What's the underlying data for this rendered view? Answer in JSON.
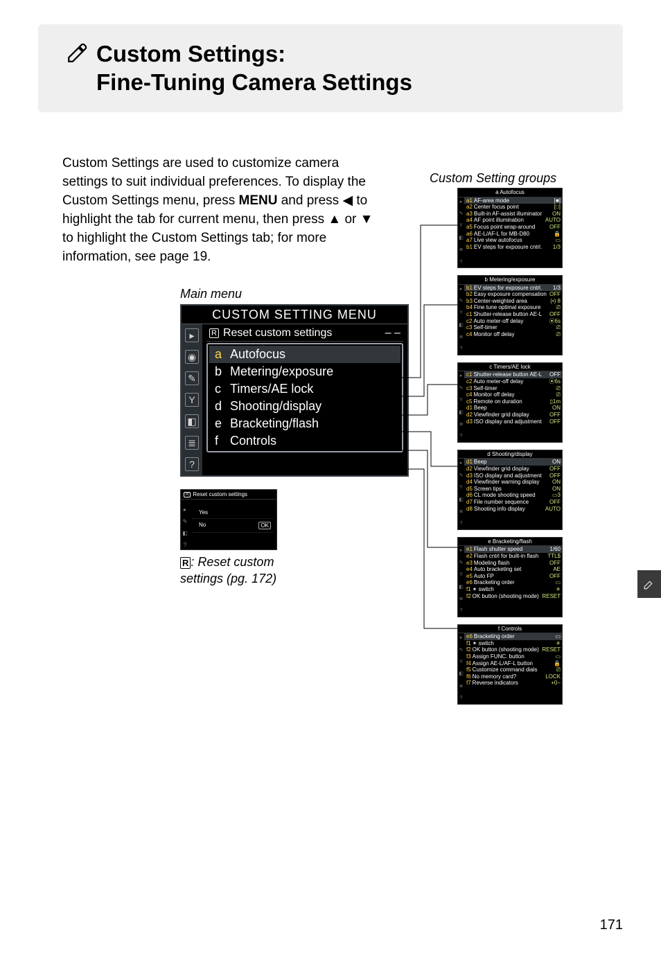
{
  "header": {
    "title_line1": "Custom Settings:",
    "title_line2": "Fine-Tuning Camera Settings"
  },
  "intro": {
    "text_a": "Custom Settings are used to customize camera settings to suit individual preferences.  To display the Custom Settings menu, press ",
    "menu_word": "MENU",
    "text_b": " and press ",
    "arrow_left": "◀",
    "text_c": " to highlight the tab for current menu, then press ",
    "arrow_up": "▲",
    "text_d": " or ",
    "arrow_down": "▼",
    "text_e": " to highlight the Custom Settings tab; for more information, see page 19."
  },
  "main_menu": {
    "caption": "Main menu",
    "title": "CUSTOM SETTING MENU",
    "reset_badge": "R",
    "reset_label": "Reset custom settings",
    "reset_value": "– –",
    "items": [
      {
        "code": "a",
        "label": "Autofocus"
      },
      {
        "code": "b",
        "label": "Metering/exposure"
      },
      {
        "code": "c",
        "label": "Timers/AE lock"
      },
      {
        "code": "d",
        "label": "Shooting/display"
      },
      {
        "code": "e",
        "label": "Bracketing/flash"
      },
      {
        "code": "f",
        "label": "Controls"
      }
    ]
  },
  "reset_dialog": {
    "head_badge": "R",
    "head_label": "Reset custom settings",
    "yes": "Yes",
    "no": "No",
    "ok": "OK"
  },
  "reset_caption": {
    "badge": "R",
    "text": ": Reset custom settings (pg. 172)"
  },
  "groups_caption": "Custom Setting groups",
  "groups": [
    {
      "title": "a Autofocus",
      "rows": [
        {
          "code": "a1",
          "name": "AF-area mode",
          "val": "[■]"
        },
        {
          "code": "a2",
          "name": "Center focus point",
          "val": "[□]"
        },
        {
          "code": "a3",
          "name": "Built-in AF-assist illuminator",
          "val": "ON"
        },
        {
          "code": "a4",
          "name": "AF point illumination",
          "val": "AUTO"
        },
        {
          "code": "a5",
          "name": "Focus point wrap-around",
          "val": "OFF"
        },
        {
          "code": "a6",
          "name": "AE-L/AF-L for MB-D80",
          "val": "🔒"
        },
        {
          "code": "a7",
          "name": "Live view autofocus",
          "val": "▭"
        },
        {
          "code": "b1",
          "name": "EV steps for exposure cntrl.",
          "val": "1/3"
        }
      ]
    },
    {
      "title": "b Metering/exposure",
      "rows": [
        {
          "code": "b1",
          "name": "EV steps for exposure cntrl.",
          "val": "1/3"
        },
        {
          "code": "b2",
          "name": "Easy exposure compensation",
          "val": "OFF"
        },
        {
          "code": "b3",
          "name": "Center-weighted area",
          "val": "(•) 8"
        },
        {
          "code": "b4",
          "name": "Fine tune optimal exposure",
          "val": "⎚"
        },
        {
          "code": "c1",
          "name": "Shutter-release button AE-L",
          "val": "OFF"
        },
        {
          "code": "c2",
          "name": "Auto meter-off delay",
          "val": "⦿6s"
        },
        {
          "code": "c3",
          "name": "Self-timer",
          "val": "⎚"
        },
        {
          "code": "c4",
          "name": "Monitor off delay",
          "val": "⎚"
        }
      ]
    },
    {
      "title": "c Timers/AE lock",
      "rows": [
        {
          "code": "c1",
          "name": "Shutter-release button AE-L",
          "val": "OFF"
        },
        {
          "code": "c2",
          "name": "Auto meter-off delay",
          "val": "⦿6s"
        },
        {
          "code": "c3",
          "name": "Self-timer",
          "val": "⎚"
        },
        {
          "code": "c4",
          "name": "Monitor off delay",
          "val": "⎚"
        },
        {
          "code": "c5",
          "name": "Remote on duration",
          "val": "▯1m"
        },
        {
          "code": "d1",
          "name": "Beep",
          "val": "ON"
        },
        {
          "code": "d2",
          "name": "Viewfinder grid display",
          "val": "OFF"
        },
        {
          "code": "d3",
          "name": "ISO display and adjustment",
          "val": "OFF"
        }
      ]
    },
    {
      "title": "d Shooting/display",
      "rows": [
        {
          "code": "d1",
          "name": "Beep",
          "val": "ON"
        },
        {
          "code": "d2",
          "name": "Viewfinder grid display",
          "val": "OFF"
        },
        {
          "code": "d3",
          "name": "ISO display and adjustment",
          "val": "OFF"
        },
        {
          "code": "d4",
          "name": "Viewfinder warning display",
          "val": "ON"
        },
        {
          "code": "d5",
          "name": "Screen tips",
          "val": "ON"
        },
        {
          "code": "d6",
          "name": "CL mode shooting speed",
          "val": "▭3"
        },
        {
          "code": "d7",
          "name": "File number sequence",
          "val": "OFF"
        },
        {
          "code": "d8",
          "name": "Shooting info display",
          "val": "AUTO"
        }
      ]
    },
    {
      "title": "e Bracketing/flash",
      "rows": [
        {
          "code": "e1",
          "name": "Flash shutter speed",
          "val": "1/60"
        },
        {
          "code": "e2",
          "name": "Flash cntrl for built-in flash",
          "val": "TTL$"
        },
        {
          "code": "e3",
          "name": "Modeling flash",
          "val": "OFF"
        },
        {
          "code": "e4",
          "name": "Auto bracketing set",
          "val": "AE"
        },
        {
          "code": "e5",
          "name": "Auto FP",
          "val": "OFF"
        },
        {
          "code": "e6",
          "name": "Bracketing order",
          "val": "▭"
        },
        {
          "code": "f1",
          "name": "✶ switch",
          "val": "✳"
        },
        {
          "code": "f2",
          "name": "OK button (shooting mode)",
          "val": "RESET"
        }
      ]
    },
    {
      "title": "f Controls",
      "rows": [
        {
          "code": "e6",
          "name": "Bracketing order",
          "val": "▭"
        },
        {
          "code": "f1",
          "name": "✶ switch",
          "val": "✳"
        },
        {
          "code": "f2",
          "name": "OK button (shooting mode)",
          "val": "RESET"
        },
        {
          "code": "f3",
          "name": "Assign FUNC. button",
          "val": "▭"
        },
        {
          "code": "f4",
          "name": "Assign AE-L/AF-L button",
          "val": "🔒"
        },
        {
          "code": "f5",
          "name": "Customize command dials",
          "val": "⎚"
        },
        {
          "code": "f6",
          "name": "No memory card?",
          "val": "LOCK"
        },
        {
          "code": "f7",
          "name": "Reverse indicators",
          "val": "+0−"
        }
      ]
    }
  ],
  "page_number": "171"
}
